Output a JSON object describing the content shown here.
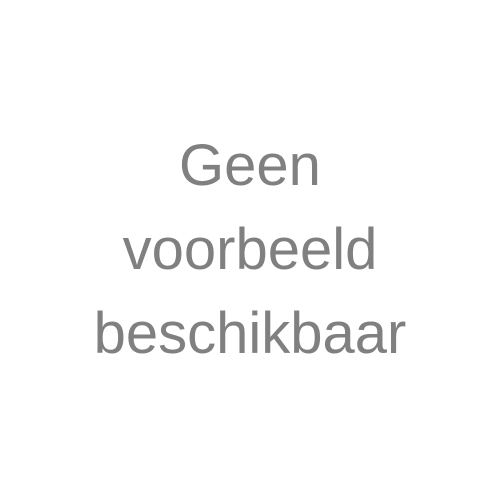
{
  "placeholder": {
    "lines": [
      "Geen",
      "voorbeeld",
      "beschikbaar"
    ]
  },
  "colors": {
    "background": "#ffffff",
    "text": "#808080"
  }
}
